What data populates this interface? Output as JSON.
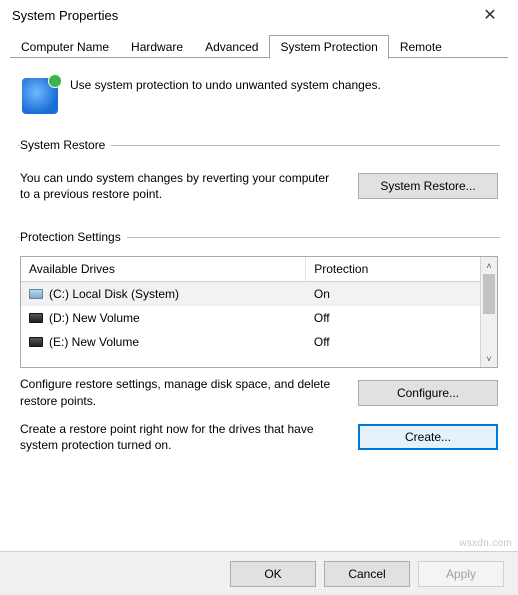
{
  "window": {
    "title": "System Properties"
  },
  "tabs": [
    {
      "label": "Computer Name"
    },
    {
      "label": "Hardware"
    },
    {
      "label": "Advanced"
    },
    {
      "label": "System Protection",
      "active": true
    },
    {
      "label": "Remote"
    }
  ],
  "intro_text": "Use system protection to undo unwanted system changes.",
  "restore_group": {
    "legend": "System Restore",
    "desc": "You can undo system changes by reverting your computer to a previous restore point.",
    "button": "System Restore..."
  },
  "settings_group": {
    "legend": "Protection Settings",
    "columns": {
      "drive": "Available Drives",
      "protection": "Protection"
    },
    "drives": [
      {
        "label": "(C:) Local Disk (System)",
        "protection": "On",
        "selected": true,
        "icon": "light"
      },
      {
        "label": "(D:) New Volume",
        "protection": "Off",
        "selected": false,
        "icon": "dark"
      },
      {
        "label": "(E:) New Volume",
        "protection": "Off",
        "selected": false,
        "icon": "dark"
      }
    ],
    "configure_desc": "Configure restore settings, manage disk space, and delete restore points.",
    "configure_button": "Configure...",
    "create_desc": "Create a restore point right now for the drives that have system protection turned on.",
    "create_button": "Create..."
  },
  "footer": {
    "ok": "OK",
    "cancel": "Cancel",
    "apply": "Apply"
  },
  "watermark": "wsxdn.com"
}
